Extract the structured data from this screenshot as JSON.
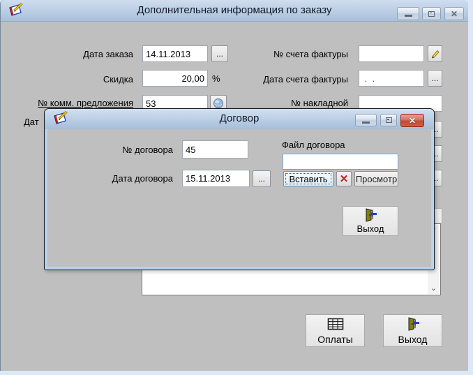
{
  "main_window": {
    "title": "Дополнительная информация по заказу",
    "titlebar_icon": "notepad-pencil-icon",
    "fields": {
      "order_date": {
        "label": "Дата заказа",
        "value": "14.11.2013",
        "browse": "..."
      },
      "discount": {
        "label": "Скидка",
        "value": "20,00",
        "suffix": "%"
      },
      "commercial_offer": {
        "label": "№ комм. предложения",
        "value": "53",
        "icon": "globe-icon"
      },
      "clipped_label": "Дат",
      "invoice_number": {
        "label": "№ счета фактуры",
        "value": "",
        "icon": "pencil-icon"
      },
      "invoice_date": {
        "label": "Дата счета фактуры",
        "value": " .  . ",
        "browse": "..."
      },
      "waybill_number": {
        "label": "№ накладной",
        "value": ""
      },
      "hidden_browse": [
        "...",
        "...",
        "..."
      ],
      "notes": {
        "value": ""
      }
    },
    "footer_buttons": {
      "payments": {
        "label": "Оплаты",
        "icon": "table-icon"
      },
      "exit": {
        "label": "Выход",
        "icon": "exit-door-icon"
      }
    }
  },
  "dialog": {
    "title": "Договор",
    "titlebar_icon": "notepad-pencil-icon",
    "contract_number": {
      "label": "№ договора",
      "value": "45"
    },
    "contract_date": {
      "label": "Дата договора",
      "value": "15.11.2013",
      "browse": "..."
    },
    "contract_file": {
      "label": "Файл договора",
      "value": ""
    },
    "file_buttons": {
      "insert": "Вставить",
      "clear_icon": "red-cross-icon",
      "view": "Просмотр"
    },
    "exit": {
      "label": "Выход",
      "icon": "exit-door-icon"
    }
  },
  "colors": {
    "titlebar": "#bacde4",
    "client_bg": "#bfbfbf",
    "close_red": "#c24a31",
    "focus_blue": "#5e9ccc"
  }
}
